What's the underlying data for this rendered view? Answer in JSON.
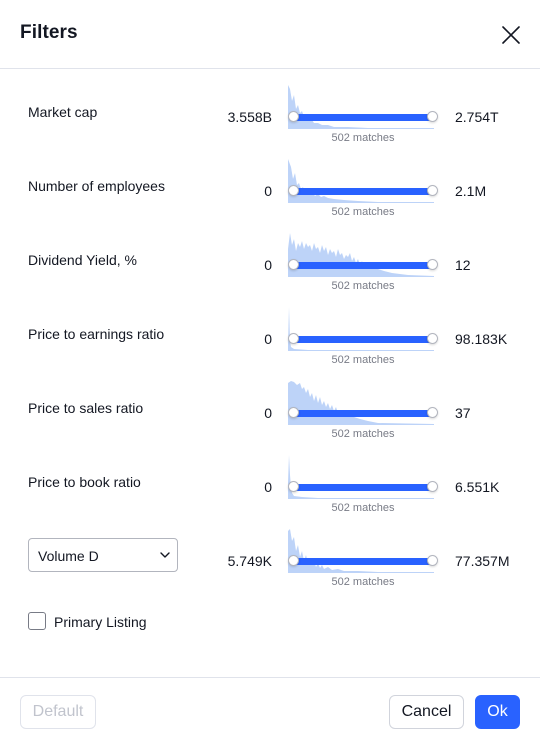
{
  "dialog": {
    "title": "Filters",
    "close_icon": "close-icon"
  },
  "accent_color": "#2962ff",
  "histogram_color": "#bdd3f8",
  "filters": [
    {
      "label": "Market cap",
      "min": "3.558B",
      "max": "2.754T",
      "matches": "502 matches"
    },
    {
      "label": "Number of employees",
      "min": "0",
      "max": "2.1M",
      "matches": "502 matches"
    },
    {
      "label": "Dividend Yield, %",
      "min": "0",
      "max": "12",
      "matches": "502 matches"
    },
    {
      "label": "Price to earnings ratio",
      "min": "0",
      "max": "98.183K",
      "matches": "502 matches"
    },
    {
      "label": "Price to sales ratio",
      "min": "0",
      "max": "37",
      "matches": "502 matches"
    },
    {
      "label": "Price to book ratio",
      "min": "0",
      "max": "6.551K",
      "matches": "502 matches"
    },
    {
      "label": "Volume D",
      "min": "5.749K",
      "max": "77.357M",
      "matches": "502 matches",
      "is_select": true
    }
  ],
  "checkbox": {
    "label": "Primary Listing",
    "checked": false
  },
  "footer": {
    "default_label": "Default",
    "cancel_label": "Cancel",
    "ok_label": "Ok"
  }
}
